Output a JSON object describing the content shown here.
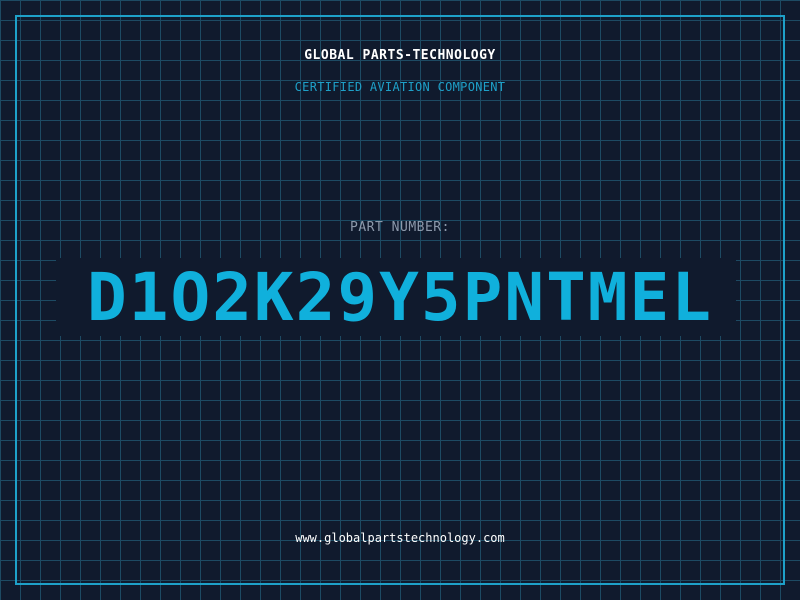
{
  "header": {
    "brand": "GLOBAL PARTS-TECHNOLOGY",
    "subtitle": "CERTIFIED AVIATION COMPONENT"
  },
  "part": {
    "label": "PART NUMBER:",
    "number": "D1O2K29Y5PNTMEL"
  },
  "footer": {
    "url": "www.globalpartstechnology.com"
  },
  "colors": {
    "background": "#101a2d",
    "grid": "#1d4a63",
    "accent": "#1ea0c8",
    "part_number": "#10b0dc",
    "label": "#8d99ab",
    "text": "#ffffff"
  }
}
